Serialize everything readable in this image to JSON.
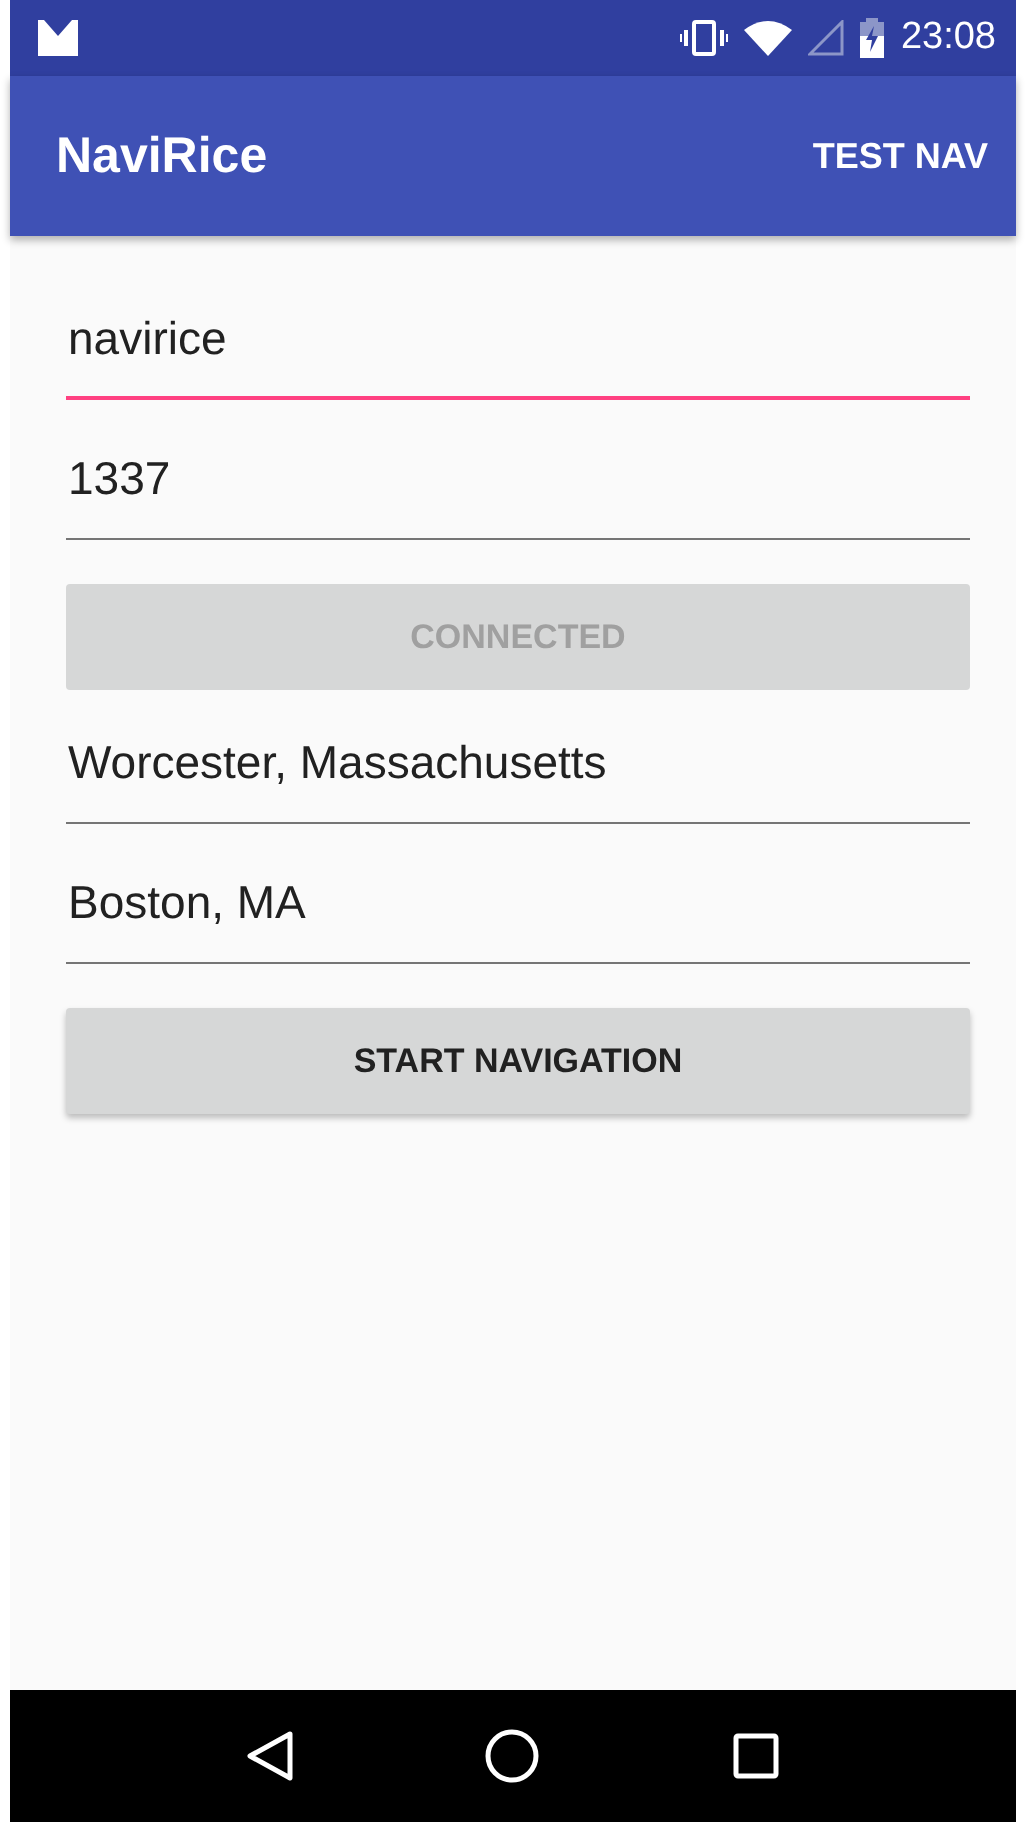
{
  "status_bar": {
    "time": "23:08"
  },
  "app_bar": {
    "title": "NaviRice",
    "action": "TEST NAV"
  },
  "form": [
    {
      "kind": "field",
      "value": "navirice",
      "focused": true
    },
    {
      "kind": "field",
      "value": "1337",
      "focused": false
    },
    {
      "kind": "button",
      "label": "CONNECTED",
      "disabled": true
    },
    {
      "kind": "field",
      "value": "Worcester, Massachusetts",
      "focused": false
    },
    {
      "kind": "field",
      "value": "Boston, MA",
      "focused": false
    },
    {
      "kind": "button",
      "label": "START NAVIGATION",
      "disabled": false
    }
  ]
}
